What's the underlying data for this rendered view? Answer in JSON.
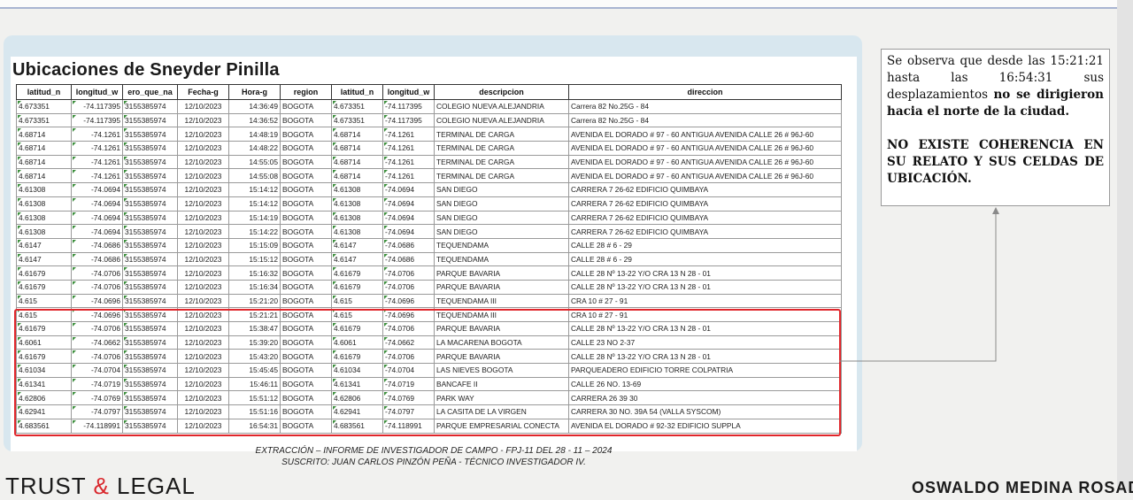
{
  "report": {
    "title": "Ubicaciones de Sneyder Pinilla",
    "columns": [
      "latitud_n",
      "longitud_w",
      "ero_que_na",
      "Fecha-g",
      "Hora-g",
      "region",
      "latitud_n",
      "longitud_w",
      "descripcion",
      "direccion"
    ],
    "rows": [
      [
        "4.673351",
        "-74.117395",
        "3155385974",
        "12/10/2023",
        "14:36:49",
        "BOGOTA",
        "4.673351",
        "-74.117395",
        "COLEGIO NUEVA ALEJANDRIA",
        "Carrera 82 No.25G - 84"
      ],
      [
        "4.673351",
        "-74.117395",
        "3155385974",
        "12/10/2023",
        "14:36:52",
        "BOGOTA",
        "4.673351",
        "-74.117395",
        "COLEGIO NUEVA ALEJANDRIA",
        "Carrera 82 No.25G - 84"
      ],
      [
        "4.68714",
        "-74.1261",
        "3155385974",
        "12/10/2023",
        "14:48:19",
        "BOGOTA",
        "4.68714",
        "-74.1261",
        "TERMINAL DE CARGA",
        "AVENIDA EL DORADO # 97 - 60 ANTIGUA AVENIDA CALLE 26 # 96J-60"
      ],
      [
        "4.68714",
        "-74.1261",
        "3155385974",
        "12/10/2023",
        "14:48:22",
        "BOGOTA",
        "4.68714",
        "-74.1261",
        "TERMINAL DE CARGA",
        "AVENIDA EL DORADO # 97 - 60 ANTIGUA AVENIDA CALLE 26 # 96J-60"
      ],
      [
        "4.68714",
        "-74.1261",
        "3155385974",
        "12/10/2023",
        "14:55:05",
        "BOGOTA",
        "4.68714",
        "-74.1261",
        "TERMINAL DE CARGA",
        "AVENIDA EL DORADO # 97 - 60 ANTIGUA AVENIDA CALLE 26 # 96J-60"
      ],
      [
        "4.68714",
        "-74.1261",
        "3155385974",
        "12/10/2023",
        "14:55:08",
        "BOGOTA",
        "4.68714",
        "-74.1261",
        "TERMINAL DE CARGA",
        "AVENIDA EL DORADO # 97 - 60 ANTIGUA AVENIDA CALLE 26 # 96J-60"
      ],
      [
        "4.61308",
        "-74.0694",
        "3155385974",
        "12/10/2023",
        "15:14:12",
        "BOGOTA",
        "4.61308",
        "-74.0694",
        "SAN DIEGO",
        "CARRERA 7 26-62 EDIFICIO QUIMBAYA"
      ],
      [
        "4.61308",
        "-74.0694",
        "3155385974",
        "12/10/2023",
        "15:14:12",
        "BOGOTA",
        "4.61308",
        "-74.0694",
        "SAN DIEGO",
        "CARRERA 7 26-62 EDIFICIO QUIMBAYA"
      ],
      [
        "4.61308",
        "-74.0694",
        "3155385974",
        "12/10/2023",
        "15:14:19",
        "BOGOTA",
        "4.61308",
        "-74.0694",
        "SAN DIEGO",
        "CARRERA 7 26-62 EDIFICIO QUIMBAYA"
      ],
      [
        "4.61308",
        "-74.0694",
        "3155385974",
        "12/10/2023",
        "15:14:22",
        "BOGOTA",
        "4.61308",
        "-74.0694",
        "SAN DIEGO",
        "CARRERA 7 26-62 EDIFICIO QUIMBAYA"
      ],
      [
        "4.6147",
        "-74.0686",
        "3155385974",
        "12/10/2023",
        "15:15:09",
        "BOGOTA",
        "4.6147",
        "-74.0686",
        "TEQUENDAMA",
        "CALLE 28 # 6 - 29"
      ],
      [
        "4.6147",
        "-74.0686",
        "3155385974",
        "12/10/2023",
        "15:15:12",
        "BOGOTA",
        "4.6147",
        "-74.0686",
        "TEQUENDAMA",
        "CALLE 28 # 6 - 29"
      ],
      [
        "4.61679",
        "-74.0706",
        "3155385974",
        "12/10/2023",
        "15:16:32",
        "BOGOTA",
        "4.61679",
        "-74.0706",
        "PARQUE BAVARIA",
        "CALLE 28 Nº 13-22 Y/O CRA 13 N 28 - 01"
      ],
      [
        "4.61679",
        "-74.0706",
        "3155385974",
        "12/10/2023",
        "15:16:34",
        "BOGOTA",
        "4.61679",
        "-74.0706",
        "PARQUE BAVARIA",
        "CALLE 28 Nº 13-22 Y/O CRA 13 N 28 - 01"
      ],
      [
        "4.615",
        "-74.0696",
        "3155385974",
        "12/10/2023",
        "15:21:20",
        "BOGOTA",
        "4.615",
        "-74.0696",
        "TEQUENDAMA III",
        "CRA 10 # 27 - 91"
      ],
      [
        "4.615",
        "-74.0696",
        "3155385974",
        "12/10/2023",
        "15:21:21",
        "BOGOTA",
        "4.615",
        "-74.0696",
        "TEQUENDAMA III",
        "CRA 10 # 27 - 91"
      ],
      [
        "4.61679",
        "-74.0706",
        "3155385974",
        "12/10/2023",
        "15:38:47",
        "BOGOTA",
        "4.61679",
        "-74.0706",
        "PARQUE BAVARIA",
        "CALLE 28 Nº 13-22 Y/O CRA 13 N 28 - 01"
      ],
      [
        "4.6061",
        "-74.0662",
        "3155385974",
        "12/10/2023",
        "15:39:20",
        "BOGOTA",
        "4.6061",
        "-74.0662",
        "LA MACARENA BOGOTA",
        "CALLE 23 NO 2-37"
      ],
      [
        "4.61679",
        "-74.0706",
        "3155385974",
        "12/10/2023",
        "15:43:20",
        "BOGOTA",
        "4.61679",
        "-74.0706",
        "PARQUE BAVARIA",
        "CALLE 28 Nº 13-22 Y/O CRA 13 N 28 - 01"
      ],
      [
        "4.61034",
        "-74.0704",
        "3155385974",
        "12/10/2023",
        "15:45:45",
        "BOGOTA",
        "4.61034",
        "-74.0704",
        "LAS NIEVES BOGOTA",
        "PARQUEADERO EDIFICIO TORRE COLPATRIA"
      ],
      [
        "4.61341",
        "-74.0719",
        "3155385974",
        "12/10/2023",
        "15:46:11",
        "BOGOTA",
        "4.61341",
        "-74.0719",
        "BANCAFE II",
        "CALLE 26 NO. 13-69"
      ],
      [
        "4.62806",
        "-74.0769",
        "3155385974",
        "12/10/2023",
        "15:51:12",
        "BOGOTA",
        "4.62806",
        "-74.0769",
        "PARK WAY",
        "CARRERA 26 39 30"
      ],
      [
        "4.62941",
        "-74.0797",
        "3155385974",
        "12/10/2023",
        "15:51:16",
        "BOGOTA",
        "4.62941",
        "-74.0797",
        "LA CASITA DE LA VIRGEN",
        "CARRERA 30 NO. 39A 54 (VALLA SYSCOM)"
      ],
      [
        "4.683561",
        "-74.118991",
        "3155385974",
        "12/10/2023",
        "16:54:31",
        "BOGOTA",
        "4.683561",
        "-74.118991",
        "PARQUE EMPRESARIAL CONECTA",
        "AVENIDA EL DORADO # 92-32 EDIFICIO SUPPLA"
      ]
    ]
  },
  "note": {
    "p1_normal": "Se observa que desde las 15:21:21 hasta las 16:54:31 sus desplazamientos",
    "p1_bold": "no se dirigieron hacia el norte de la ciudad.",
    "p2_bold": "NO EXISTE COHERENCIA EN SU RELATO Y SUS CELDAS DE UBICACIÓN."
  },
  "caption": {
    "line1": "EXTRACCIÓN – INFORME DE INVESTIGADOR DE CAMPO - FPJ-11 DEL 28 - 11 – 2024",
    "line2": "SUSCRITO: JUAN CARLOS PINZÓN PEÑA - TÉCNICO INVESTIGADOR IV."
  },
  "footer": {
    "brand_left": "TRUST",
    "brand_amp": "&",
    "brand_right": "LEGAL",
    "signature": "OSWALDO MEDINA ROSADA"
  },
  "colors": {
    "highlight_box": "#e0262b",
    "card_background": "#d8e7ef"
  }
}
